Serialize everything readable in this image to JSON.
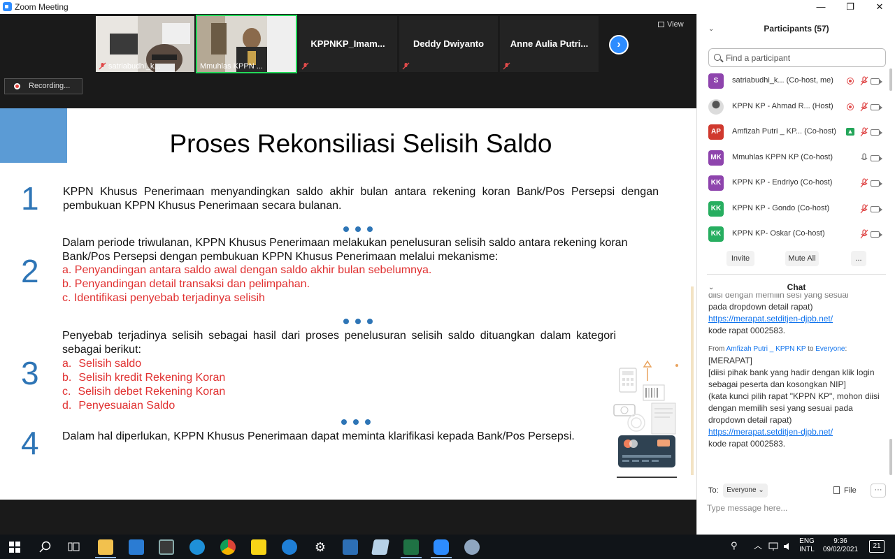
{
  "window": {
    "title": "Zoom Meeting",
    "minimize": "—",
    "maximize": "❐",
    "close": "✕"
  },
  "video": {
    "tiles": [
      {
        "name": "satriabudhi_k...",
        "type": "photo"
      },
      {
        "name": "Mmuhlas KPPN ...",
        "type": "photo"
      },
      {
        "name": "KPPNKP_Imam...",
        "type": "name"
      },
      {
        "name": "Deddy Dwiyanto",
        "type": "name"
      },
      {
        "name": "Anne Aulia Putri...",
        "type": "name"
      }
    ],
    "next_label": "›",
    "view_label": "View",
    "recording_label": "Recording..."
  },
  "slide": {
    "title": "Proses Rekonsiliasi Selisih Saldo",
    "s1_num": "1",
    "s1_text": "KPPN Khusus Penerimaan menyandingkan saldo akhir bulan antara rekening koran Bank/Pos Persepsi dengan pembukuan KPPN Khusus Penerimaan secara bulanan.",
    "s2_num": "2",
    "s2_text": "Dalam periode triwulanan, KPPN Khusus Penerimaan melakukan penelusuran selisih saldo antara rekening koran Bank/Pos Persepsi dengan pembukuan KPPN Khusus Penerimaan melalui mekanisme:",
    "s2_items": [
      "a. Penyandingan antara saldo awal dengan saldo akhir bulan sebelumnya.",
      "b. Penyandingan detail transaksi dan pelimpahan.",
      "c. Identifikasi penyebab terjadinya selisih"
    ],
    "s3_num": "3",
    "s3_text": "Penyebab terjadinya selisih sebagai hasil dari proses penelusuran selisih saldo dituangkan dalam kategori sebagai berikut:",
    "s3_items": [
      {
        "letter": "a.",
        "text": "Selisih saldo"
      },
      {
        "letter": "b.",
        "text": "Selisih kredit Rekening Koran"
      },
      {
        "letter": "c.",
        "text": "Selisih debet Rekening Koran"
      },
      {
        "letter": "d.",
        "text": "Penyesuaian Saldo"
      }
    ],
    "s4_num": "4",
    "s4_text": "Dalam hal diperlukan, KPPN Khusus Penerimaan dapat meminta klarifikasi kepada Bank/Pos Persepsi."
  },
  "participants": {
    "header": "Participants (57)",
    "search_placeholder": "Find a participant",
    "list": [
      {
        "initials": "S",
        "color": "#8e44ad",
        "name": "satriabudhi_k...  (Co-host, me)",
        "rec": true
      },
      {
        "initials": "",
        "color": "#bfbfbf",
        "name": "KPPN KP - Ahmad R...  (Host)",
        "rec": true
      },
      {
        "initials": "AP",
        "color": "#d0392e",
        "name": "Amfizah Putri _ KP... (Co-host)",
        "share": true
      },
      {
        "initials": "MK",
        "color": "#8e44ad",
        "name": "Mmuhlas KPPN KP (Co-host)",
        "mic_on": true
      },
      {
        "initials": "KK",
        "color": "#8e44ad",
        "name": "KPPN KP - Endriyo (Co-host)"
      },
      {
        "initials": "KK",
        "color": "#27ae60",
        "name": "KPPN KP - Gondo (Co-host)"
      },
      {
        "initials": "KK",
        "color": "#27ae60",
        "name": "KPPN KP- Oskar (Co-host)"
      }
    ],
    "invite": "Invite",
    "mute_all": "Mute All",
    "more": "..."
  },
  "chat": {
    "header": "Chat",
    "top_cut": "diisi dengan memilih sesi yang sesuai",
    "l1": "pada dropdown detail rapat)",
    "link1": "https://merapat.setditjen-djpb.net/",
    "l2": "kode rapat 0002583.",
    "from_prefix": "From ",
    "from_name": "Amfizah Putri _ KPPN KP",
    "from_to": " to ",
    "from_target": "Everyone",
    "from_suffix": ":",
    "m1": "[MERAPAT]",
    "m2": "[diisi pihak bank yang hadir dengan klik login sebagai peserta dan kosongkan NIP]",
    "m3": "(kata kunci pilih rapat \"KPPN KP\", mohon diisi dengan memilih sesi yang sesuai pada dropdown detail rapat)",
    "link2": "https://merapat.setditjen-djpb.net/",
    "m4": "kode rapat 0002583.",
    "to_label": "To:",
    "to_value": "Everyone ⌄",
    "file_label": "File",
    "more_label": "···",
    "input_placeholder": "Type message here..."
  },
  "taskbar": {
    "lang1": "ENG",
    "lang2": "INTL",
    "time": "9:36",
    "date": "09/02/2021",
    "notif": "21"
  }
}
